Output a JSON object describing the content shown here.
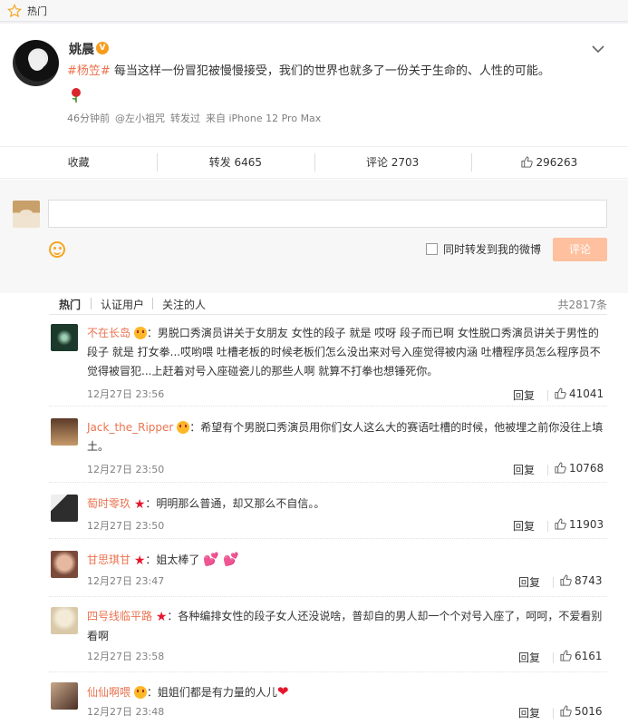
{
  "topbar": {
    "label": "热门"
  },
  "post": {
    "author": "姚晨",
    "verified": "V",
    "tag": "#杨笠#",
    "text": " 每当这样一份冒犯被慢慢接受，我们的世界也就多了一份关于生命的、人性的可能。",
    "rose": "🌹",
    "meta": {
      "time": "46分钟前",
      "via": "@左小祖咒",
      "forward": "转发过",
      "source": "来自 iPhone 12 Pro Max"
    }
  },
  "actions": {
    "collect": "收藏",
    "forward": "转发 6465",
    "comment": "评论 2703",
    "like": "296263"
  },
  "composer": {
    "placeholder": "",
    "also_forward": "同时转发到我的微博",
    "submit": "评论"
  },
  "filters": {
    "hot": "热门",
    "verified": "认证用户",
    "following": "关注的人",
    "total": "共2817条"
  },
  "comments": [
    {
      "name": "不在长岛",
      "badge": "yellow",
      "text": "：男脱口秀演员讲关于女朋友 女性的段子 就是 哎呀 段子而已啊 女性脱口秀演员讲关于男性的段子 就是 打女拳...哎哟喂 吐槽老板的时候老板们怎么没出来对号入座觉得被内涵 吐槽程序员怎么程序员不觉得被冒犯...上赶着对号入座碰瓷儿的那些人啊 就算不打拳也想锤死你。",
      "time": "12月27日 23:56",
      "reply": "回复",
      "likes": "41041",
      "avatar_color": "#1b3a2c"
    },
    {
      "name": "Jack_the_Ripper",
      "badge": "yellow",
      "text": "：希望有个男脱口秀演员用你们女人这么大的赛语吐槽的时候，他被埋之前你没往上填土。",
      "time": "12月27日 23:50",
      "reply": "回复",
      "likes": "10768",
      "avatar_color": "#8a5a3c"
    },
    {
      "name": "萄时零玖",
      "badge": "star",
      "text": "：明明那么普通，却又那么不自信。。",
      "time": "12月27日 23:50",
      "reply": "回复",
      "likes": "11903",
      "avatar_color": "#2d2d2d"
    },
    {
      "name": "甘思琪甘",
      "badge": "star",
      "text": "：姐太棒了",
      "time": "12月27日 23:47",
      "reply": "回复",
      "likes": "8743",
      "avatar_color": "#b07a6a"
    },
    {
      "name": "四号线临平路",
      "badge": "star",
      "text": "：各种编排女性的段子女人还没说啥，普却自的男人却一个个对号入座了，呵呵，不爱看别看啊",
      "time": "12月27日 23:58",
      "reply": "回复",
      "likes": "6161",
      "avatar_color": "#d9c9a8"
    },
    {
      "name": "仙仙啊喂",
      "badge": "yellow",
      "text": "：姐姐们都是有力量的人儿",
      "time": "12月27日 23:48",
      "reply": "回复",
      "likes": "5016",
      "avatar_color": "#6b4a3a"
    }
  ]
}
